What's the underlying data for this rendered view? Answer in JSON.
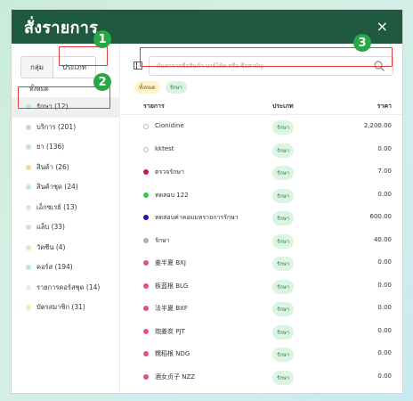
{
  "modal": {
    "title": "สั่งรายการ",
    "close": "×"
  },
  "sidebar": {
    "tabs": [
      "กลุ่ม",
      "ประเภท"
    ],
    "all_label": "ทั้งหมด",
    "categories": [
      {
        "label": "รักษา (12)",
        "color": "#bde7d5"
      },
      {
        "label": "บริการ (201)",
        "color": "#b9dcf3"
      },
      {
        "label": "ยา (136)",
        "color": "#bfe8d8"
      },
      {
        "label": "สินค้า (26)",
        "color": "#f4dba3"
      },
      {
        "label": "สินค้าชุด (24)",
        "color": "#c2eccc"
      },
      {
        "label": "เอ็กซเรย์ (13)",
        "color": "#e2dcf5"
      },
      {
        "label": "แล็บ (33)",
        "color": "#c4e8ec"
      },
      {
        "label": "วัคซีน (4)",
        "color": "#f0e3b8"
      },
      {
        "label": "คอร์ส (194)",
        "color": "#bde3f0"
      },
      {
        "label": "รายการคอร์สชุด (14)",
        "color": "#ebe6f7"
      },
      {
        "label": "บัตรสมาชิก (31)",
        "color": "#f5e6b3"
      }
    ]
  },
  "search": {
    "placeholder": "ค้นหาจากชื่อสินค้า บาร์โค้ด หรือ ชื่อสามัญ"
  },
  "filters": [
    "ทั้งหมด",
    "รักษา"
  ],
  "table": {
    "headers": {
      "name": "รายการ",
      "type": "ประเภท",
      "price": "ราคา"
    },
    "rows": [
      {
        "name": "Cionidine",
        "type": "รักษา",
        "price": "2,200.00",
        "dot": "outline"
      },
      {
        "name": "kktest",
        "type": "รักษา",
        "price": "0.00",
        "dot": "outline"
      },
      {
        "name": "ตรวจรักษา",
        "type": "รักษา",
        "price": "7.00",
        "dot": "#c2185b"
      },
      {
        "name": "ทดสอบ 122",
        "type": "รักษา",
        "price": "0.00",
        "dot": "#2ecc40"
      },
      {
        "name": "ทดสอบค่าคอมมหรายการรักษา",
        "type": "รักษา",
        "price": "600.00",
        "dot": "#1e1aa8"
      },
      {
        "name": "รักษา",
        "type": "รักษา",
        "price": "40.00",
        "dot": "#b0b0b0"
      },
      {
        "name": "姜半夏 BXJ",
        "type": "รักษา",
        "price": "0.00",
        "dot": "#e94f7c"
      },
      {
        "name": "板蓝根 BLG",
        "type": "รักษา",
        "price": "0.00",
        "dot": "#e94f7c"
      },
      {
        "name": "法半夏 BXF",
        "type": "รักษา",
        "price": "0.00",
        "dot": "#e94f7c"
      },
      {
        "name": "炮姜炭 PJT",
        "type": "รักษา",
        "price": "0.00",
        "dot": "#e94f7c"
      },
      {
        "name": "糯稻根 NDG",
        "type": "รักษา",
        "price": "0.00",
        "dot": "#e94f7c"
      },
      {
        "name": "酒女贞子 NZZ",
        "type": "รักษา",
        "price": "0.00",
        "dot": "#e94f7c"
      }
    ]
  },
  "callouts": [
    "1",
    "2",
    "3"
  ]
}
